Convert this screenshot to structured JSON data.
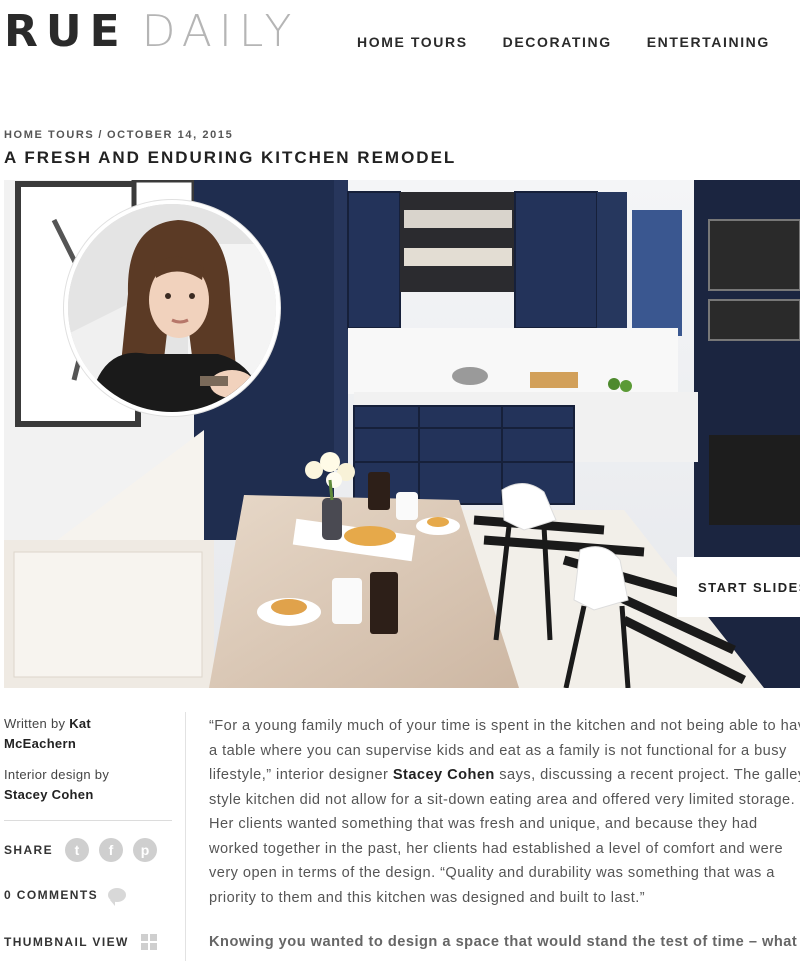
{
  "header": {
    "logo_part1": "RUE",
    "logo_part2": "DAILY",
    "nav": [
      "HOME TOURS",
      "DECORATING",
      "ENTERTAINING"
    ]
  },
  "post": {
    "category": "HOME TOURS",
    "separator": "/",
    "date": "OCTOBER 14, 2015",
    "title": "A FRESH AND ENDURING KITCHEN REMODEL",
    "slideshow_label": "START SLIDESHOW"
  },
  "sidebar": {
    "written_by_label": "Written by",
    "author_first": "Kat",
    "author_last": "McEachern",
    "design_label": "Interior design by",
    "designer": "Stacey Cohen",
    "share_label": "SHARE",
    "share_icons": [
      "twitter-icon",
      "facebook-icon",
      "pinterest-icon"
    ],
    "comments_label": "0 COMMENTS",
    "thumbnail_label": "THUMBNAIL VIEW"
  },
  "article": {
    "l1": "“For a young family much of your time is spent in the kitchen and not being able to have",
    "l2": "a table where you can supervise kids and eat as a family is not functional for a busy",
    "l3_pre": "lifestyle,” interior designer ",
    "l3_name": "Stacey Cohen",
    "l3_post": " says, discussing a recent project. The galley-",
    "l4": "style kitchen did not allow for a sit-down eating area and offered very limited storage.",
    "l5": "Her clients wanted something that was fresh and unique, and because they had",
    "l6": "worked together in the past, her clients had established a level of comfort and were",
    "l7": "very open in terms of the design. “Quality and durability was something that was a",
    "l8": "priority to them and this kitchen was designed and built to last.”",
    "lead": "Knowing you wanted to design a space that would stand the test of time – what was"
  },
  "colors": {
    "cabinet_navy": "#1f2d4f",
    "logo_dark": "#2a2a2a",
    "logo_light": "#b5b5b5"
  }
}
